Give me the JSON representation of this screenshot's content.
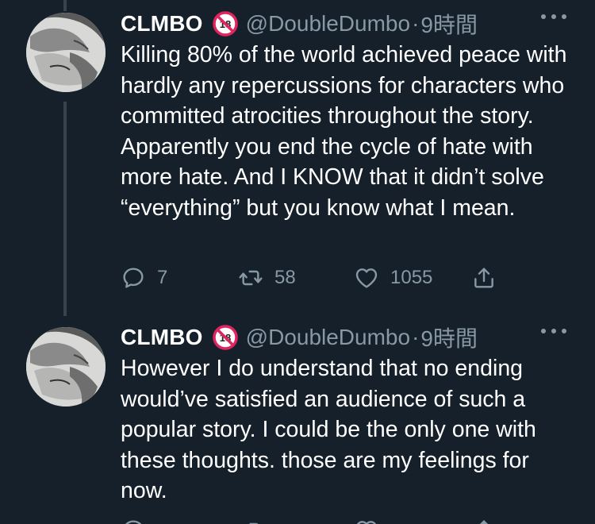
{
  "tweets": [
    {
      "display_name": "CLMBO",
      "badge_icon": "no-under-18-icon",
      "handle": "@DoubleDumbo",
      "separator": "·",
      "time": "9時間",
      "text": "Killing 80% of the world achieved peace with hardly any repercussions for characters who committed atrocities throughout the story. Apparently you end the cycle of hate with more hate. And I KNOW that it didn’t solve “everything” but you know what I mean.",
      "replies": "7",
      "retweets": "58",
      "likes": "1055"
    },
    {
      "display_name": "CLMBO",
      "badge_icon": "no-under-18-icon",
      "handle": "@DoubleDumbo",
      "separator": "·",
      "time": "9時間",
      "text": "However I do understand that no ending would’ve satisfied an audience of such a popular story. I could be the only one with these thoughts. those are my feelings for now."
    }
  ],
  "colors": {
    "background": "#15202b",
    "text": "#ffffff",
    "muted": "#8899a6",
    "thread_line": "#38444d",
    "badge_red": "#e0245e"
  }
}
